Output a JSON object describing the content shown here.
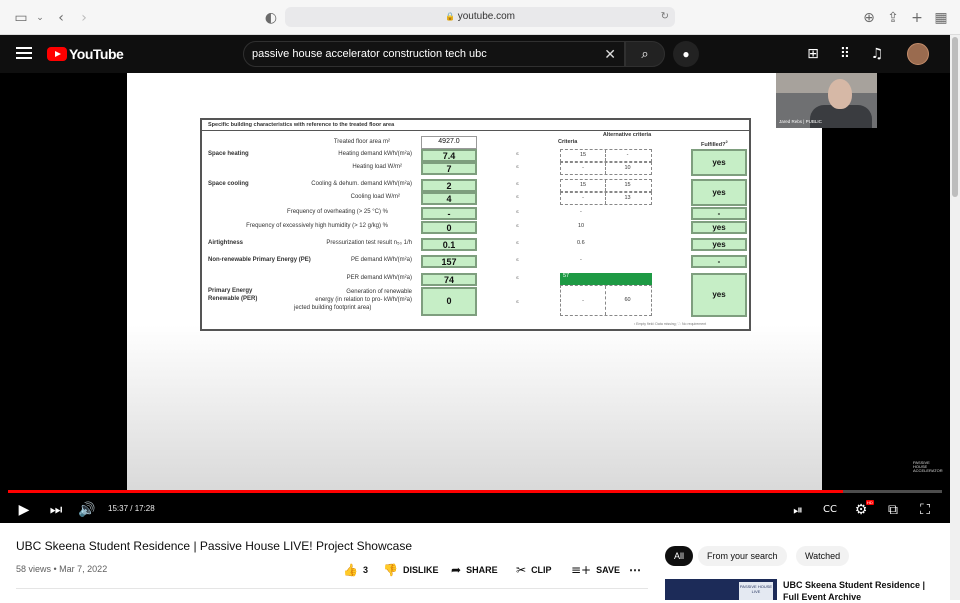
{
  "browser": {
    "url": "youtube.com",
    "icons": [
      "sidebar-icon",
      "chevron-down-icon",
      "back-icon",
      "forward-icon",
      "shield-icon",
      "lock-icon",
      "reload-icon",
      "download-icon",
      "share-icon",
      "new-tab-icon",
      "tab-overview-icon"
    ]
  },
  "header": {
    "logo_text": "YouTube",
    "search_value": "passive house accelerator construction tech ubc",
    "icons": [
      "hamburger-icon",
      "search-icon",
      "mic-icon",
      "create-icon",
      "apps-icon",
      "bell-icon"
    ]
  },
  "player": {
    "webcam_name": "Jared Rebs | PUBLIC",
    "corner_logo": [
      "PASSIVE",
      "HOUSE",
      "ACCELERATOR"
    ],
    "time": "15:37 / 17:28",
    "progress": 0.894,
    "hd_badge": "HD",
    "slide": {
      "header": "Specific building characteristics with reference to the treated floor area",
      "col_criteria": "Criteria",
      "col_alt": "Alternative criteria",
      "col_fulfilled": "Fulfilled?",
      "fulfilled_sup": "2",
      "footnote": "² Empty field: Data missing; '-': No requirement",
      "tfa_label": "Treated floor area m²",
      "tfa_value": "4927.0",
      "cat_space_heating": "Space heating",
      "cat_space_cooling": "Space cooling",
      "cat_airtightness": "Airtightness",
      "cat_nre": "Non-renewable Primary Energy (PE)",
      "cat_per_1": "Primary Energy",
      "cat_per_2": "Renewable (PER)",
      "le": "≤",
      "rows": {
        "heating_demand": {
          "label": "Heating demand kWh/(m²a)",
          "value": "7.4",
          "crit": "15",
          "alt": "-"
        },
        "heating_load": {
          "label": "Heating load W/m²",
          "value": "7",
          "crit": "-",
          "alt": "10"
        },
        "cooling_demand": {
          "label": "Cooling & dehum. demand kWh/(m²a)",
          "value": "2",
          "crit": "15",
          "alt": "15"
        },
        "cooling_load": {
          "label": "Cooling load W/m²",
          "value": "4",
          "crit": "-",
          "alt": "13"
        },
        "overheating": {
          "label": "Frequency of overheating (> 25 °C) %",
          "value": "-",
          "crit": "-"
        },
        "humidity": {
          "label": "Frequency of excessively high humidity (> 12 g/kg) %",
          "value": "0",
          "crit": "10"
        },
        "pressurization": {
          "label": "Pressurization test result n₅₀ 1/h",
          "value": "0.1",
          "crit": "0.6"
        },
        "pe_demand": {
          "label": "PE demand kWh/(m²a)",
          "value": "157",
          "crit": "-"
        },
        "per_demand": {
          "label": "PER demand kWh/(m²a)",
          "value": "74",
          "crit": "57"
        },
        "generation_1": "Generation of renewable",
        "generation_2": "energy (in relation to pro- kWh/(m²a)",
        "generation_3": "jected building footprint area)",
        "generation_value": "0",
        "generation_crit": "-",
        "generation_alt": "60"
      },
      "fulfilled": {
        "heating": "yes",
        "cooling": "yes",
        "overheating": "-",
        "humidity": "yes",
        "airtightness": "yes",
        "nre": "-",
        "per": "yes"
      }
    }
  },
  "video": {
    "title": "UBC Skeena Student Residence | Passive House LIVE! Project Showcase",
    "meta": "58 views • Mar 7, 2022",
    "like_count": "3",
    "dislike_label": "DISLIKE",
    "share_label": "SHARE",
    "clip_label": "CLIP",
    "save_label": "SAVE",
    "more_label": "⋯"
  },
  "chips": [
    "All",
    "From your search",
    "Watched"
  ],
  "recommendation": {
    "title": "UBC Skeena Student Residence | Full Event Archive",
    "thumb_text": "PASSIVE HOUSE LIVE"
  }
}
